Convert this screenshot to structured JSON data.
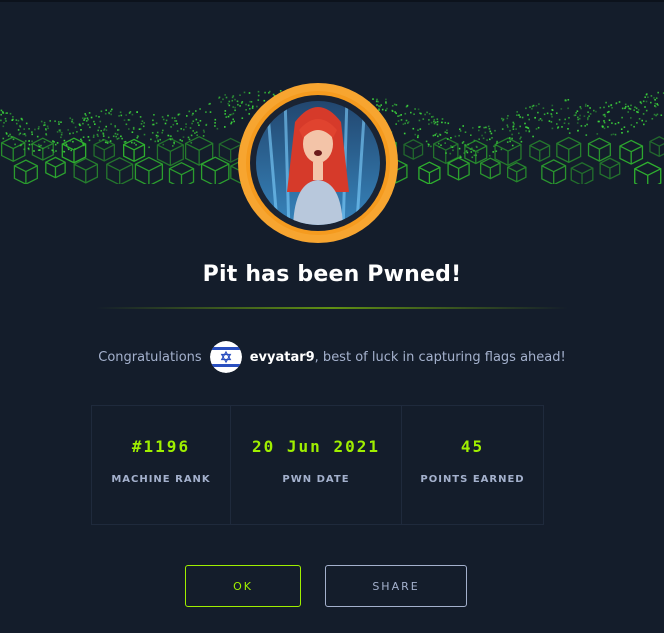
{
  "modal": {
    "title": "Pit has been Pwned!",
    "congrats_prefix": "Congratulations",
    "username": "evyatar9",
    "congrats_suffix": ", best of luck in capturing flags ahead!",
    "flag_icon": "israel-flag-icon",
    "avatar_icon": "machine-avatar-pit"
  },
  "stats": [
    {
      "value": "#1196",
      "label": "MACHINE RANK"
    },
    {
      "value": "20 Jun 2021",
      "label": "PWN DATE"
    },
    {
      "value": "45",
      "label": "POINTS EARNED"
    }
  ],
  "buttons": {
    "ok": "OK",
    "share": "SHARE"
  },
  "colors": {
    "background": "#141d2b",
    "accent": "#9fef00",
    "text": "#a4b1cd",
    "badge_ring": "#f7a530"
  }
}
